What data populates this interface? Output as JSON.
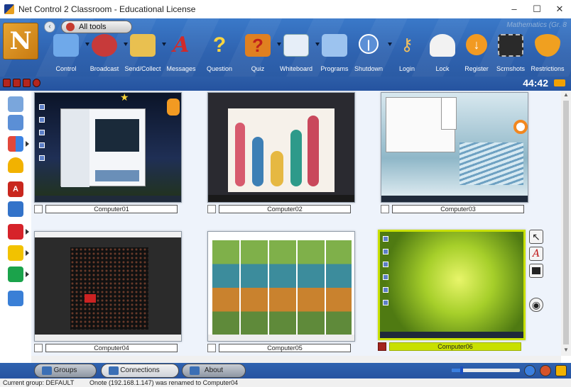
{
  "window": {
    "title": "Net Control 2 Classroom - Educational License",
    "minimize": "–",
    "maximize": "☐",
    "close": "✕"
  },
  "ribbon": {
    "back_glyph": "‹",
    "all_tools_label": "All tools",
    "subject_label": "Mathematics (Gr. 8",
    "tools": [
      {
        "label": "Control",
        "icon": "monitor-icon"
      },
      {
        "label": "Broadcast",
        "icon": "broadcast-icon"
      },
      {
        "label": "Send/Collect",
        "icon": "folder-icon"
      },
      {
        "label": "Messages",
        "icon": "messages-icon"
      },
      {
        "label": "Question",
        "icon": "question-icon"
      },
      {
        "label": "Quiz",
        "icon": "quiz-icon"
      },
      {
        "label": "Whiteboard",
        "icon": "whiteboard-icon"
      },
      {
        "label": "Programs",
        "icon": "programs-icon"
      },
      {
        "label": "Shutdown",
        "icon": "power-icon"
      },
      {
        "label": "Login",
        "icon": "key-icon"
      },
      {
        "label": "Lock",
        "icon": "lock-icon"
      },
      {
        "label": "Register",
        "icon": "register-icon"
      },
      {
        "label": "Scrnshots",
        "icon": "film-icon"
      },
      {
        "label": "Restrictions",
        "icon": "shield-icon"
      }
    ]
  },
  "timer": "44:42",
  "computers": [
    {
      "name": "Computer01",
      "selected": false
    },
    {
      "name": "Computer02",
      "selected": false
    },
    {
      "name": "Computer03",
      "selected": false
    },
    {
      "name": "Computer04",
      "selected": false
    },
    {
      "name": "Computer05",
      "selected": false
    },
    {
      "name": "Computer06",
      "selected": true
    }
  ],
  "bottom_nav": {
    "groups_label": "Groups",
    "connections_label": "Connections",
    "about_label": "About",
    "zoom_level": 0.15
  },
  "status": {
    "current_group": "Current group: DEFAULT",
    "message": "Onote (192.168.1.147) was renamed to Computer04"
  },
  "colors": {
    "ribbon_blue": "#2f63b0",
    "selected_tile": "#c8e000",
    "accent_red": "#b3261e"
  }
}
